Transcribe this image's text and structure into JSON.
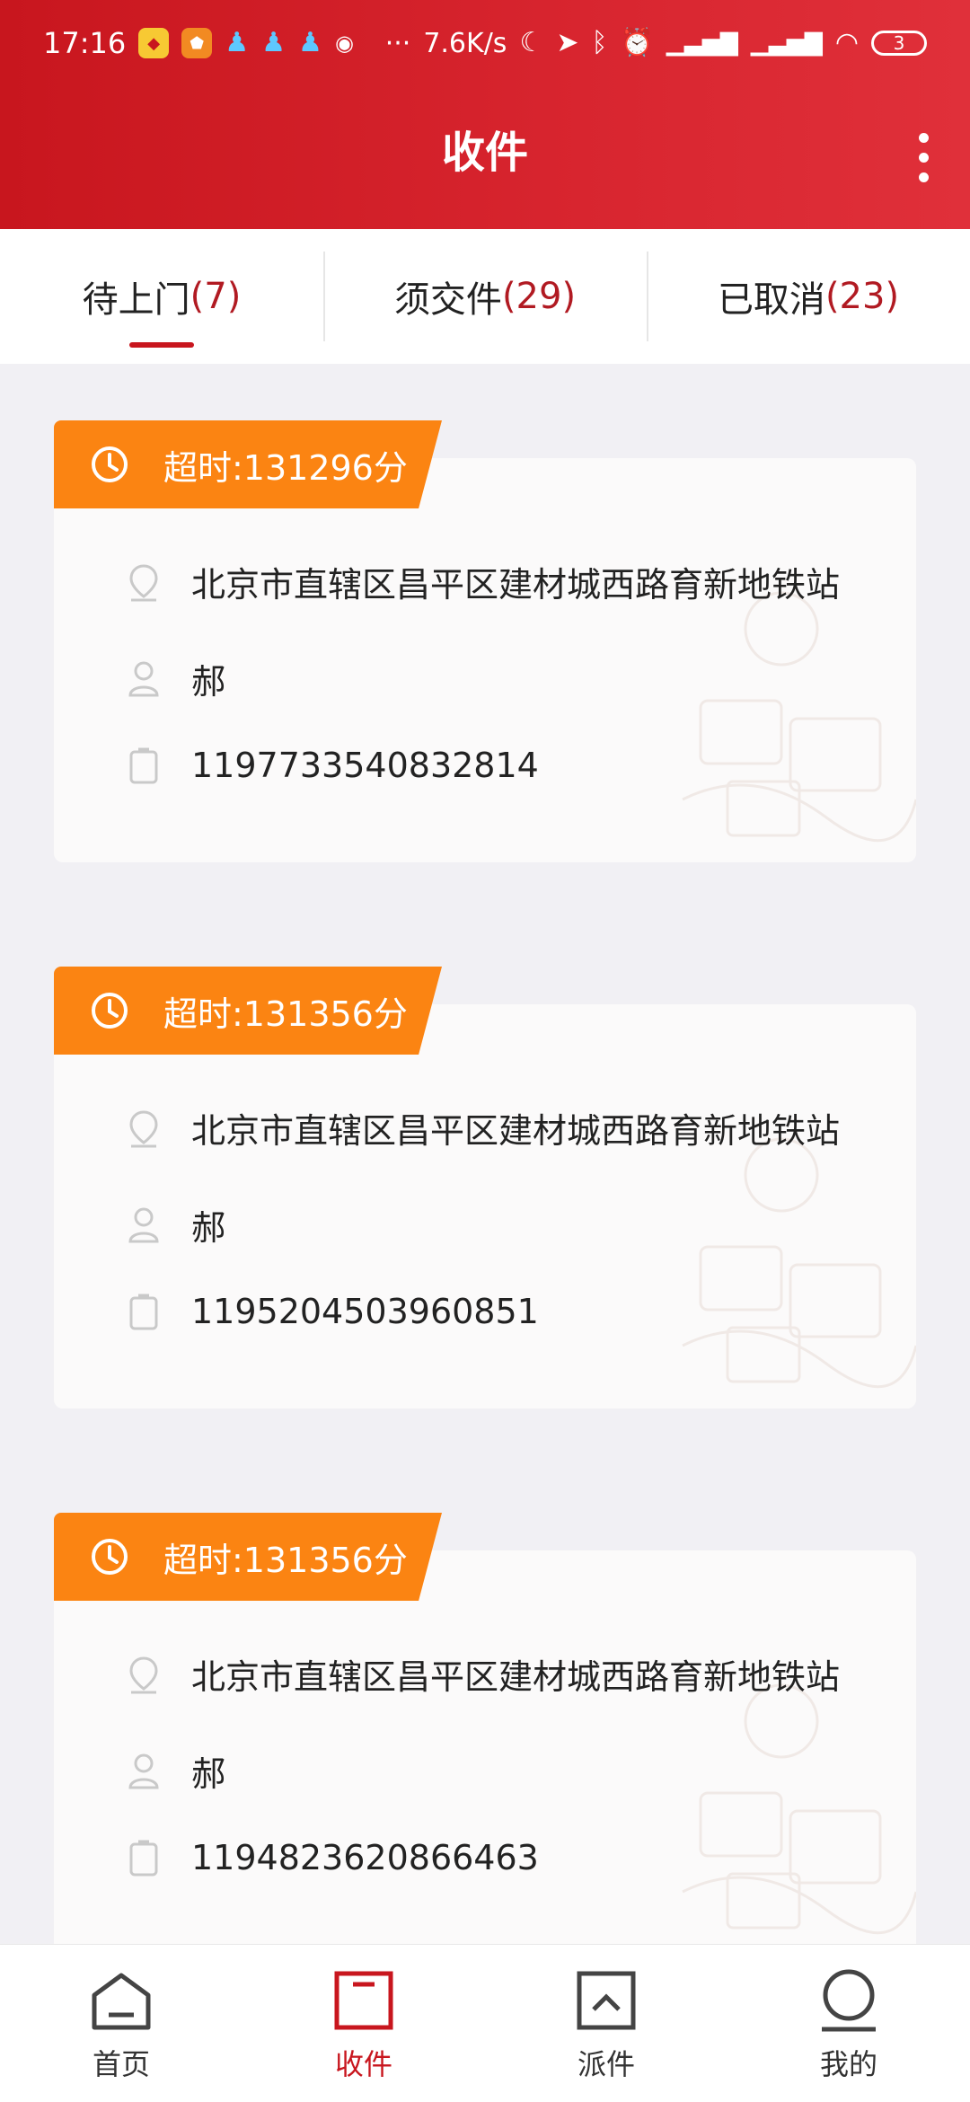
{
  "status_bar": {
    "time": "17:16",
    "net_speed": "7.6K/s",
    "battery": "3",
    "dots": "···"
  },
  "header": {
    "title": "收件",
    "more_icon": "more-vertical-icon"
  },
  "tabs": [
    {
      "label": "待上门",
      "count": "(7)",
      "active": true
    },
    {
      "label": "须交件",
      "count": "(29)",
      "active": false
    },
    {
      "label": "已取消",
      "count": "(23)",
      "active": false
    }
  ],
  "orders": [
    {
      "timeout": "超时:131296分",
      "address": "北京市直辖区昌平区建材城西路育新地铁站",
      "name": "郝",
      "order_id": "1197733540832814"
    },
    {
      "timeout": "超时:131356分",
      "address": "北京市直辖区昌平区建材城西路育新地铁站",
      "name": "郝",
      "order_id": "1195204503960851"
    },
    {
      "timeout": "超时:131356分",
      "address": "北京市直辖区昌平区建材城西路育新地铁站",
      "name": "郝",
      "order_id": "1194823620866463"
    }
  ],
  "bottom_nav": [
    {
      "label": "首页",
      "icon": "home-icon",
      "active": false
    },
    {
      "label": "收件",
      "icon": "receive-icon",
      "active": true
    },
    {
      "label": "派件",
      "icon": "dispatch-icon",
      "active": false
    },
    {
      "label": "我的",
      "icon": "profile-icon",
      "active": false
    }
  ],
  "colors": {
    "brand_red": "#c8161e",
    "timeout_orange": "#fb8412",
    "background": "#f1f0f4"
  }
}
